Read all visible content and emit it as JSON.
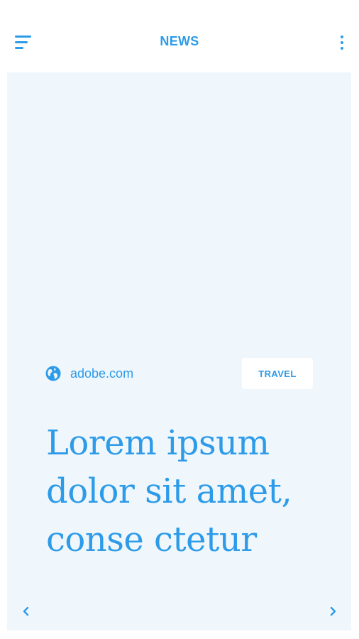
{
  "header": {
    "title": "NEWS",
    "menu_icon": "hamburger-menu-icon",
    "more_icon": "more-vertical-icon"
  },
  "article": {
    "source": "adobe.com",
    "source_icon": "globe-icon",
    "category": "TRAVEL",
    "headline": "Lorem ipsum dolor sit amet, conse ctetur"
  },
  "pager": {
    "prev_icon": "chevron-left-icon",
    "next_icon": "chevron-right-icon"
  },
  "colors": {
    "accent": "#2d9be8",
    "card_background": "#eff7fc",
    "page_background": "#ffffff"
  }
}
